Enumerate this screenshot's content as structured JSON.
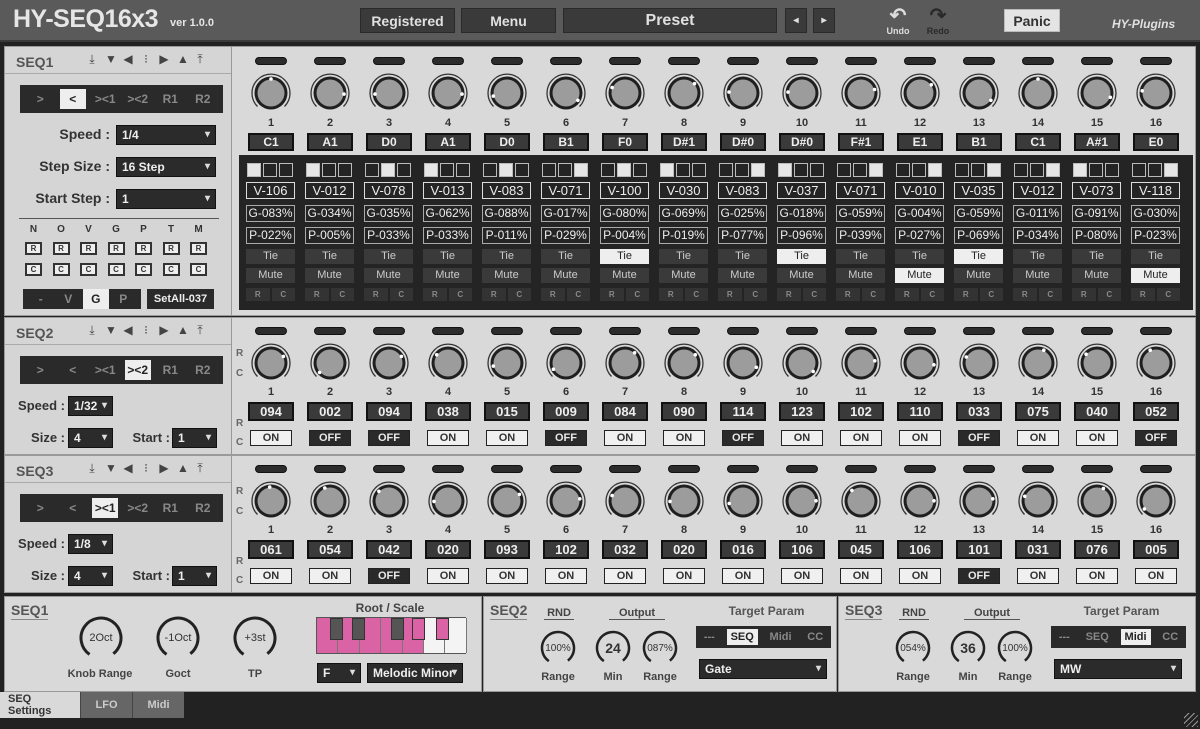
{
  "header": {
    "title": "HY-SEQ16x3",
    "version": "ver 1.0.0",
    "registered": "Registered",
    "menu": "Menu",
    "preset": "Preset",
    "prev": "◂",
    "next": "▸",
    "undo": "Undo",
    "redo": "Redo",
    "panic": "Panic",
    "brand": "HY-Plugins"
  },
  "nav_icons": [
    "⤓",
    "▼",
    "◀",
    "⁝",
    "▶",
    "▲",
    "⤒"
  ],
  "seq1": {
    "name": "SEQ1",
    "directions": [
      ">",
      "<",
      "><1",
      "><2",
      "R1",
      "R2"
    ],
    "active_direction": 1,
    "speed_label": "Speed :",
    "speed": "1/4",
    "stepsize_label": "Step Size :",
    "stepsize": "16 Step",
    "startstep_label": "Start Step :",
    "startstep": "1",
    "rc_headers": [
      "N",
      "O",
      "V",
      "G",
      "P",
      "T",
      "M"
    ],
    "r_label": "R",
    "c_label": "C",
    "modes": [
      "-",
      "V",
      "G",
      "P"
    ],
    "active_mode": 2,
    "setall": "SetAll-037",
    "steps": [
      {
        "n": "1",
        "note": "C1",
        "knob": 0.5,
        "sel": 0,
        "v": "V-106",
        "g": "G-083%",
        "p": "P-022%",
        "tie": false,
        "mute": false
      },
      {
        "n": "2",
        "note": "A1",
        "knob": 0.85,
        "sel": 0,
        "v": "V-012",
        "g": "G-034%",
        "p": "P-005%",
        "tie": false,
        "mute": false
      },
      {
        "n": "3",
        "note": "D0",
        "knob": 0.15,
        "sel": 1,
        "v": "V-078",
        "g": "G-035%",
        "p": "P-033%",
        "tie": false,
        "mute": false
      },
      {
        "n": "4",
        "note": "A1",
        "knob": 0.85,
        "sel": 0,
        "v": "V-013",
        "g": "G-062%",
        "p": "P-033%",
        "tie": false,
        "mute": false
      },
      {
        "n": "5",
        "note": "D0",
        "knob": 0.12,
        "sel": 1,
        "v": "V-083",
        "g": "G-088%",
        "p": "P-011%",
        "tie": false,
        "mute": false
      },
      {
        "n": "6",
        "note": "B1",
        "knob": 0.95,
        "sel": 2,
        "v": "V-071",
        "g": "G-017%",
        "p": "P-029%",
        "tie": false,
        "mute": false
      },
      {
        "n": "7",
        "note": "F0",
        "knob": 0.25,
        "sel": 1,
        "v": "V-100",
        "g": "G-080%",
        "p": "P-004%",
        "tie": true,
        "mute": false
      },
      {
        "n": "8",
        "note": "D#1",
        "knob": 0.68,
        "sel": 0,
        "v": "V-030",
        "g": "G-069%",
        "p": "P-019%",
        "tie": false,
        "mute": false
      },
      {
        "n": "9",
        "note": "D#0",
        "knob": 0.18,
        "sel": 2,
        "v": "V-083",
        "g": "G-025%",
        "p": "P-077%",
        "tie": false,
        "mute": false
      },
      {
        "n": "10",
        "note": "D#0",
        "knob": 0.18,
        "sel": 0,
        "v": "V-037",
        "g": "G-018%",
        "p": "P-096%",
        "tie": true,
        "mute": false
      },
      {
        "n": "11",
        "note": "F#1",
        "knob": 0.78,
        "sel": 2,
        "v": "V-071",
        "g": "G-059%",
        "p": "P-039%",
        "tie": false,
        "mute": false
      },
      {
        "n": "12",
        "note": "E1",
        "knob": 0.7,
        "sel": 2,
        "v": "V-010",
        "g": "G-004%",
        "p": "P-027%",
        "tie": false,
        "mute": true
      },
      {
        "n": "13",
        "note": "B1",
        "knob": 0.95,
        "sel": 2,
        "v": "V-035",
        "g": "G-059%",
        "p": "P-069%",
        "tie": true,
        "mute": false
      },
      {
        "n": "14",
        "note": "C1",
        "knob": 0.5,
        "sel": 2,
        "v": "V-012",
        "g": "G-011%",
        "p": "P-034%",
        "tie": false,
        "mute": false
      },
      {
        "n": "15",
        "note": "A#1",
        "knob": 0.9,
        "sel": 0,
        "v": "V-073",
        "g": "G-091%",
        "p": "P-080%",
        "tie": false,
        "mute": false
      },
      {
        "n": "16",
        "note": "E0",
        "knob": 0.2,
        "sel": 2,
        "v": "V-118",
        "g": "G-030%",
        "p": "P-023%",
        "tie": false,
        "mute": true
      }
    ],
    "tie_label": "Tie",
    "mute_label": "Mute"
  },
  "seq2": {
    "name": "SEQ2",
    "directions": [
      ">",
      "<",
      "><1",
      "><2",
      "R1",
      "R2"
    ],
    "active_direction": 3,
    "speed_label": "Speed :",
    "speed": "1/32",
    "size_label": "Size :",
    "size": "4",
    "start_label": "Start :",
    "start": "1",
    "steps": [
      {
        "n": "1",
        "val": "094",
        "on": true,
        "knob": 0.73
      },
      {
        "n": "2",
        "val": "002",
        "on": false,
        "knob": 0.01
      },
      {
        "n": "3",
        "val": "094",
        "on": false,
        "knob": 0.73
      },
      {
        "n": "4",
        "val": "038",
        "on": true,
        "knob": 0.3
      },
      {
        "n": "5",
        "val": "015",
        "on": true,
        "knob": 0.12
      },
      {
        "n": "6",
        "val": "009",
        "on": false,
        "knob": 0.07
      },
      {
        "n": "7",
        "val": "084",
        "on": true,
        "knob": 0.66
      },
      {
        "n": "8",
        "val": "090",
        "on": true,
        "knob": 0.7
      },
      {
        "n": "9",
        "val": "114",
        "on": false,
        "knob": 0.9
      },
      {
        "n": "10",
        "val": "123",
        "on": true,
        "knob": 0.97
      },
      {
        "n": "11",
        "val": "102",
        "on": true,
        "knob": 0.8
      },
      {
        "n": "12",
        "val": "110",
        "on": true,
        "knob": 0.86
      },
      {
        "n": "13",
        "val": "033",
        "on": false,
        "knob": 0.26
      },
      {
        "n": "14",
        "val": "075",
        "on": true,
        "knob": 0.59
      },
      {
        "n": "15",
        "val": "040",
        "on": true,
        "knob": 0.31
      },
      {
        "n": "16",
        "val": "052",
        "on": false,
        "knob": 0.41
      }
    ]
  },
  "seq3": {
    "name": "SEQ3",
    "directions": [
      ">",
      "<",
      "><1",
      "><2",
      "R1",
      "R2"
    ],
    "active_direction": 2,
    "speed_label": "Speed :",
    "speed": "1/8",
    "size_label": "Size :",
    "size": "4",
    "start_label": "Start :",
    "start": "1",
    "steps": [
      {
        "n": "1",
        "val": "061",
        "on": true,
        "knob": 0.48
      },
      {
        "n": "2",
        "val": "054",
        "on": true,
        "knob": 0.42
      },
      {
        "n": "3",
        "val": "042",
        "on": false,
        "knob": 0.33
      },
      {
        "n": "4",
        "val": "020",
        "on": true,
        "knob": 0.16
      },
      {
        "n": "5",
        "val": "093",
        "on": true,
        "knob": 0.73
      },
      {
        "n": "6",
        "val": "102",
        "on": true,
        "knob": 0.8
      },
      {
        "n": "7",
        "val": "032",
        "on": true,
        "knob": 0.25
      },
      {
        "n": "8",
        "val": "020",
        "on": true,
        "knob": 0.16
      },
      {
        "n": "9",
        "val": "016",
        "on": true,
        "knob": 0.13
      },
      {
        "n": "10",
        "val": "106",
        "on": true,
        "knob": 0.83
      },
      {
        "n": "11",
        "val": "045",
        "on": true,
        "knob": 0.35
      },
      {
        "n": "12",
        "val": "106",
        "on": true,
        "knob": 0.83
      },
      {
        "n": "13",
        "val": "101",
        "on": false,
        "knob": 0.8
      },
      {
        "n": "14",
        "val": "031",
        "on": true,
        "knob": 0.24
      },
      {
        "n": "15",
        "val": "076",
        "on": true,
        "knob": 0.6
      },
      {
        "n": "16",
        "val": "005",
        "on": true,
        "knob": 0.04
      }
    ]
  },
  "rc_side": {
    "r": "R",
    "c": "C"
  },
  "bottom": {
    "seq1": {
      "name": "SEQ1",
      "knob_range": "2Oct",
      "knob_range_label": "Knob Range",
      "goct": "-1Oct",
      "goct_label": "Goct",
      "tp": "+3st",
      "tp_label": "TP",
      "root_scale_label": "Root / Scale",
      "root": "F",
      "scale": "Melodic Minor",
      "scale_color": "#d963a4"
    },
    "seq2": {
      "name": "SEQ2",
      "rnd_label": "RND",
      "output_label": "Output",
      "rnd_range": "100%",
      "rnd_range_label": "Range",
      "min": "24",
      "min_label": "Min",
      "out_range": "087%",
      "out_range_label": "Range",
      "target_label": "Target Param",
      "targets": [
        "---",
        "SEQ",
        "Midi",
        "CC"
      ],
      "active_target": 1,
      "target_value": "Gate"
    },
    "seq3": {
      "name": "SEQ3",
      "rnd_label": "RND",
      "output_label": "Output",
      "rnd_range": "054%",
      "rnd_range_label": "Range",
      "min": "36",
      "min_label": "Min",
      "out_range": "100%",
      "out_range_label": "Range",
      "target_label": "Target Param",
      "targets": [
        "---",
        "SEQ",
        "Midi",
        "CC"
      ],
      "active_target": 2,
      "target_value": "MW"
    }
  },
  "tabs": [
    {
      "label": "SEQ Settings",
      "active": true
    },
    {
      "label": "LFO",
      "active": false
    },
    {
      "label": "Midi",
      "active": false
    }
  ]
}
